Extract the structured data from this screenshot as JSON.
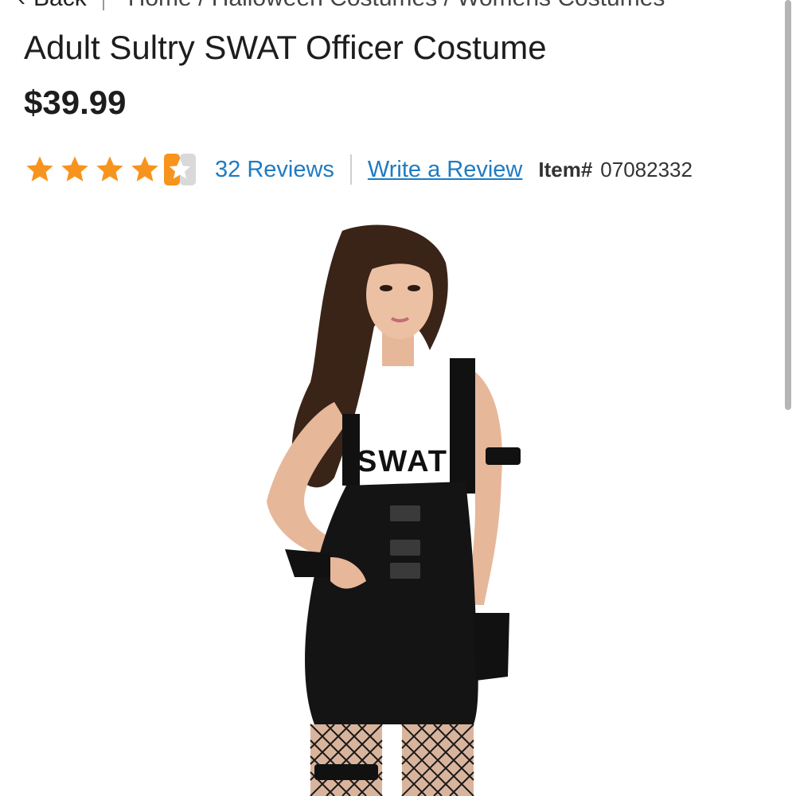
{
  "nav": {
    "back_label": "Back",
    "breadcrumb": "Home / Halloween Costumes / Womens Costumes"
  },
  "product": {
    "title": "Adult Sultry SWAT Officer Costume",
    "price": "$39.99",
    "rating": 4.5,
    "rating_max": 5,
    "reviews_label": "32 Reviews",
    "write_review_label": "Write a Review",
    "item_label": "Item#",
    "item_number": "07082332",
    "image_alt": "Woman wearing black SWAT officer costume dress with buckles, arm band, fingerless gloves and fishnet stockings",
    "shirt_text": "SWAT"
  },
  "colors": {
    "star": "#f7941d",
    "link": "#1f7bc1",
    "text": "#1d1d1d"
  }
}
